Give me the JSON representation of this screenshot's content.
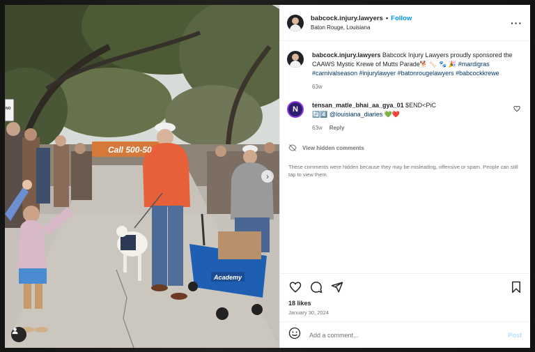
{
  "post": {
    "username": "babcock.injury.lawyers",
    "separator": "•",
    "follow_label": "Follow",
    "location": "Baton Rouge, Louisiana",
    "more_icon": "more-horizontal-icon"
  },
  "photo": {
    "banner_text": "Call 500-50",
    "wagon_brand": "Academy",
    "sign_text": "NO KING ZONE",
    "next_icon": "chevron-right-icon",
    "tags_icon": "user-tag-icon"
  },
  "caption": {
    "username": "babcock.injury.lawyers",
    "text": "Babcock Injury Lawyers proudly sponsored the CAAWS Mystic Krewe of Mutts Parade🐕 🦴 🐾 🎉",
    "hashtags": "#mardigras #carnivalseason #injurylawyer #batonrougelawyers #babcockkrewe",
    "time": "63w"
  },
  "comment": {
    "avatar_letter": "N",
    "username": "tensan_matle_bhai_aa_gya_01",
    "text_start": "$END<PiC",
    "text_mid": "🔄4️⃣",
    "mention": "@louisiana_diaries",
    "text_end": "💚❤️",
    "time": "63w",
    "reply_label": "Reply"
  },
  "hidden": {
    "link_label": "View hidden comments",
    "note": "These comments were hidden because they may be misleading, offensive or spam. People can still tap to view them."
  },
  "stats": {
    "likes": "18 likes",
    "date": "January 30, 2024"
  },
  "composer": {
    "placeholder": "Add a comment...",
    "post_label": "Post"
  },
  "colors": {
    "accent": "#0095f6",
    "text": "#262626",
    "muted": "#737373",
    "hashtag": "#00376b",
    "post_disabled": "#b2dffc"
  }
}
